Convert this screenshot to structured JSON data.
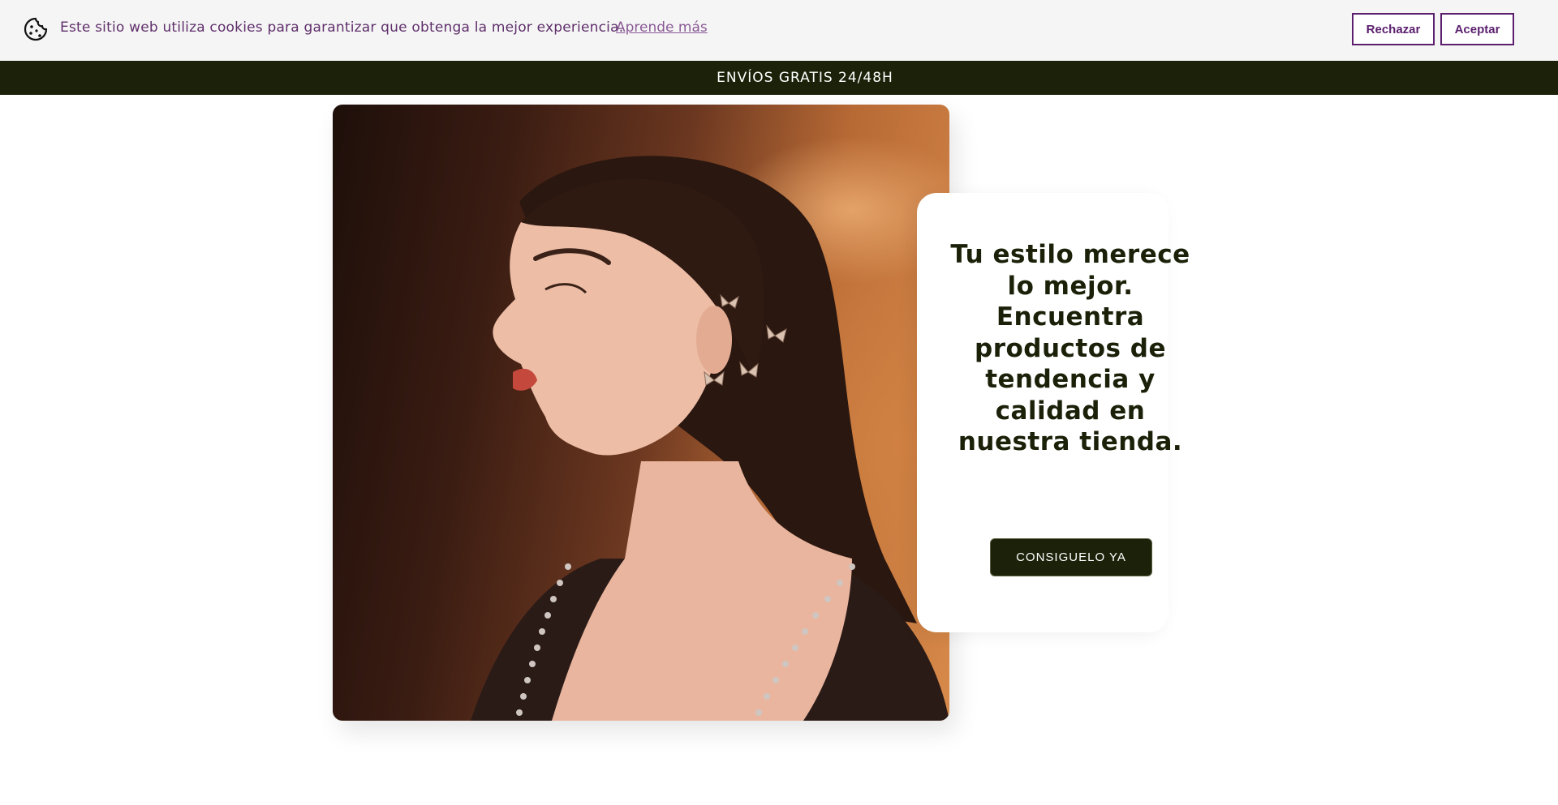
{
  "cookie_banner": {
    "icon": "cookie-icon",
    "message": "Este sitio web utiliza cookies para garantizar que obtenga la mejor experiencia.",
    "learn_more": "Aprende más",
    "reject_label": "Rechazar",
    "accept_label": "Aceptar",
    "text_color": "#5f2f6b",
    "button_color": "#5b1f6e"
  },
  "announcement": {
    "text": "ENVÍOS GRATIS 24/48H",
    "background": "#1b2209"
  },
  "hero": {
    "heading": "Tu estilo merece lo mejor. Encuentra productos de tendencia y calidad en nuestra tienda.",
    "cta_label": "CONSIGUELO YA",
    "image_icon": "model-earrings-photo"
  }
}
